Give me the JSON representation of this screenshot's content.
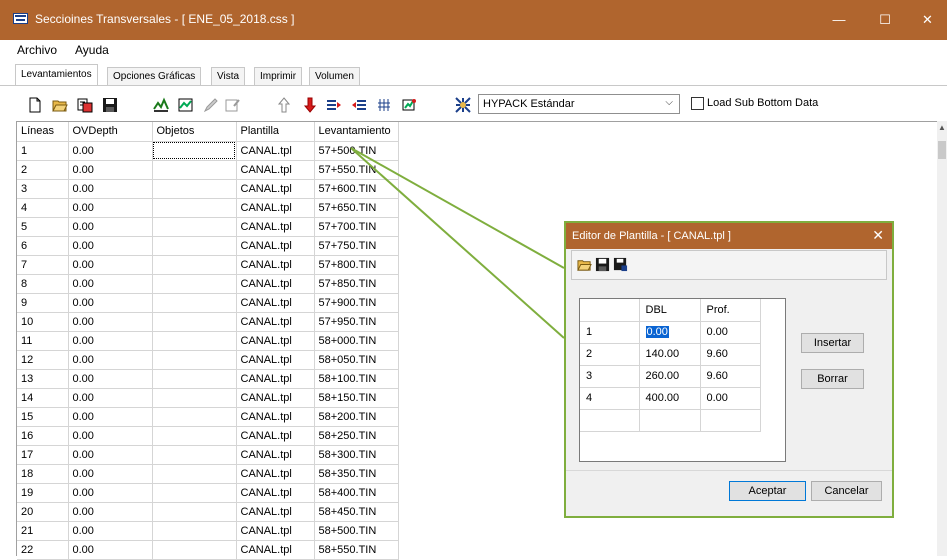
{
  "window": {
    "title": "Seccioines Transversales - [ ENE_05_2018.css ]",
    "minimize": "—",
    "maximize": "☐",
    "close": "✕"
  },
  "menu": [
    "Archivo",
    "Ayuda"
  ],
  "tabs": [
    "Levantamientos",
    "Opciones Gráficas",
    "Vista",
    "Imprimir",
    "Volumen"
  ],
  "toolbar": {
    "combo_value": "HYPACK Estándar",
    "combo_arrow": "⌵",
    "checkbox_label": "Load Sub Bottom Data",
    "icons": [
      "new-file-icon",
      "open-folder-icon",
      "export-icon",
      "save-icon",
      "profile-icon",
      "section-icon",
      "pencil-icon",
      "properties-icon",
      "arrow-up-icon",
      "arrow-down-icon",
      "shift-right-icon",
      "shift-left-icon",
      "grid-icon",
      "tools-icon",
      "settings-icon"
    ]
  },
  "grid": {
    "columns": [
      "Líneas",
      "OVDepth",
      "Objetos",
      "Plantilla",
      "Levantamiento"
    ],
    "rows": [
      [
        "1",
        "0.00",
        "",
        "CANAL.tpl",
        "57+500.TIN"
      ],
      [
        "2",
        "0.00",
        "",
        "CANAL.tpl",
        "57+550.TIN"
      ],
      [
        "3",
        "0.00",
        "",
        "CANAL.tpl",
        "57+600.TIN"
      ],
      [
        "4",
        "0.00",
        "",
        "CANAL.tpl",
        "57+650.TIN"
      ],
      [
        "5",
        "0.00",
        "",
        "CANAL.tpl",
        "57+700.TIN"
      ],
      [
        "6",
        "0.00",
        "",
        "CANAL.tpl",
        "57+750.TIN"
      ],
      [
        "7",
        "0.00",
        "",
        "CANAL.tpl",
        "57+800.TIN"
      ],
      [
        "8",
        "0.00",
        "",
        "CANAL.tpl",
        "57+850.TIN"
      ],
      [
        "9",
        "0.00",
        "",
        "CANAL.tpl",
        "57+900.TIN"
      ],
      [
        "10",
        "0.00",
        "",
        "CANAL.tpl",
        "57+950.TIN"
      ],
      [
        "11",
        "0.00",
        "",
        "CANAL.tpl",
        "58+000.TIN"
      ],
      [
        "12",
        "0.00",
        "",
        "CANAL.tpl",
        "58+050.TIN"
      ],
      [
        "13",
        "0.00",
        "",
        "CANAL.tpl",
        "58+100.TIN"
      ],
      [
        "14",
        "0.00",
        "",
        "CANAL.tpl",
        "58+150.TIN"
      ],
      [
        "15",
        "0.00",
        "",
        "CANAL.tpl",
        "58+200.TIN"
      ],
      [
        "16",
        "0.00",
        "",
        "CANAL.tpl",
        "58+250.TIN"
      ],
      [
        "17",
        "0.00",
        "",
        "CANAL.tpl",
        "58+300.TIN"
      ],
      [
        "18",
        "0.00",
        "",
        "CANAL.tpl",
        "58+350.TIN"
      ],
      [
        "19",
        "0.00",
        "",
        "CANAL.tpl",
        "58+400.TIN"
      ],
      [
        "20",
        "0.00",
        "",
        "CANAL.tpl",
        "58+450.TIN"
      ],
      [
        "21",
        "0.00",
        "",
        "CANAL.tpl",
        "58+500.TIN"
      ],
      [
        "22",
        "0.00",
        "",
        "CANAL.tpl",
        "58+550.TIN"
      ]
    ]
  },
  "dialog": {
    "title": "Editor de Plantilla - [ CANAL.tpl ]",
    "close": "✕",
    "columns": [
      "",
      "DBL",
      "Prof."
    ],
    "rows": [
      [
        "1",
        "0.00",
        "0.00"
      ],
      [
        "2",
        "140.00",
        "9.60"
      ],
      [
        "3",
        "260.00",
        "9.60"
      ],
      [
        "4",
        "400.00",
        "0.00"
      ]
    ],
    "insert_label": "Insertar",
    "delete_label": "Borrar",
    "accept_label": "Aceptar",
    "cancel_label": "Cancelar"
  },
  "colors": {
    "titlebar": "#b0652e",
    "callout_border": "#7fae3e",
    "selection": "#0a64d2"
  }
}
